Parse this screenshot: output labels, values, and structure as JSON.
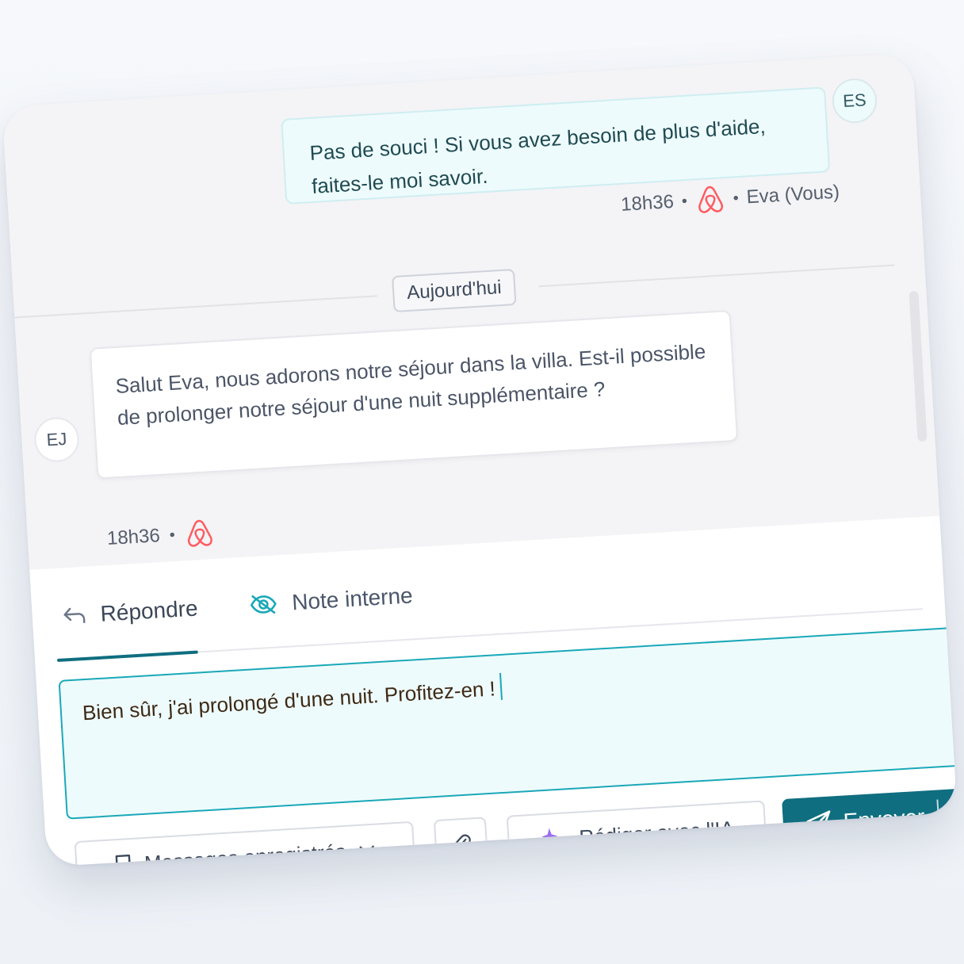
{
  "thread": {
    "outgoing": {
      "avatar": "ES",
      "text": "Pas de souci ! Si vous avez besoin de plus d'aide, faites-le moi savoir.",
      "time": "18h36",
      "sender": "Eva (Vous)",
      "channel_icon": "airbnb-icon"
    },
    "day_divider": "Aujourd'hui",
    "incoming": {
      "avatar": "EJ",
      "text": "Salut Eva, nous adorons notre séjour dans la villa. Est-il possible de prolonger notre séjour d'une nuit supplémentaire ?",
      "time": "18h36",
      "channel_icon": "airbnb-icon"
    }
  },
  "composer": {
    "tabs": [
      {
        "label": "Répondre",
        "icon": "reply-arrow-icon",
        "active": true
      },
      {
        "label": "Note interne",
        "icon": "eye-off-icon",
        "active": false
      }
    ],
    "message": "Bien sûr, j'ai prolongé d'une nuit. Profitez-en !",
    "saved_messages_label": "Messages enregistrés",
    "ai_label": "Rédiger avec l'IA",
    "send_label": "Envoyer"
  },
  "colors": {
    "accent": "#0f6e80",
    "accent_border": "#1aa8b8",
    "airbnb": "#ff5a5f",
    "ai_sparkle": "#9b6bf2"
  }
}
